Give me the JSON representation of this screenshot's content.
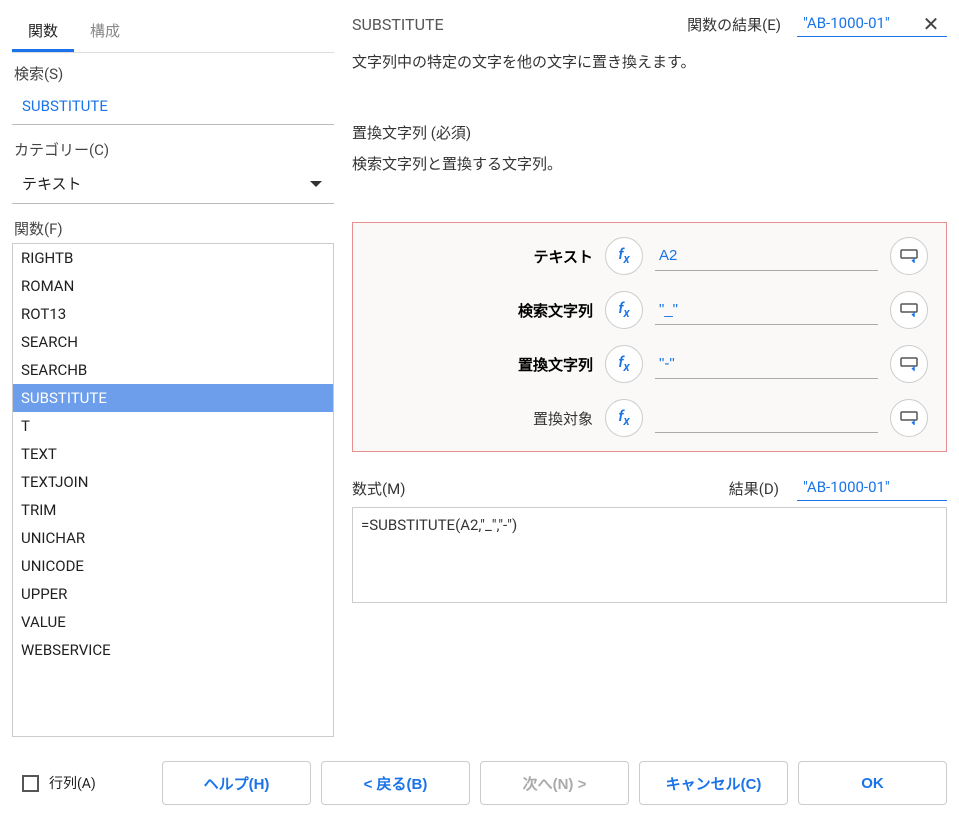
{
  "close_icon": "close-icon",
  "tabs": {
    "items": [
      {
        "label": "関数"
      },
      {
        "label": "構成"
      }
    ],
    "active_index": 0
  },
  "search": {
    "label": "検索(S)",
    "value": "SUBSTITUTE"
  },
  "category": {
    "label": "カテゴリー(C)",
    "value": "テキスト"
  },
  "functions": {
    "label": "関数(F)",
    "items": [
      "RIGHTB",
      "ROMAN",
      "ROT13",
      "SEARCH",
      "SEARCHB",
      "SUBSTITUTE",
      "T",
      "TEXT",
      "TEXTJOIN",
      "TRIM",
      "UNICHAR",
      "UNICODE",
      "UPPER",
      "VALUE",
      "WEBSERVICE"
    ],
    "selected": "SUBSTITUTE"
  },
  "right": {
    "title": "SUBSTITUTE",
    "result_e_label": "関数の結果(E)",
    "result_e_value": "\"AB-1000-01\"",
    "description": "文字列中の特定の文字を他の文字に置き換えます。",
    "param_help_title": "置換文字列 (必須)",
    "param_help_desc": "検索文字列と置換する文字列。",
    "params": [
      {
        "label": "テキスト",
        "value": "A2",
        "bold": true
      },
      {
        "label": "検索文字列",
        "value": "\"_\"",
        "bold": true
      },
      {
        "label": "置換文字列",
        "value": "\"-\"",
        "bold": true
      },
      {
        "label": "置換対象",
        "value": "",
        "bold": false
      }
    ],
    "formula_label": "数式(M)",
    "result_d_label": "結果(D)",
    "result_d_value": "\"AB-1000-01\"",
    "formula_value": "=SUBSTITUTE(A2,\"_\",\"-\")"
  },
  "footer": {
    "array_label": "行列(A)",
    "help": "ヘルプ(H)",
    "back": "< 戻る(B)",
    "next": "次へ(N) >",
    "cancel": "キャンセル(C)",
    "ok": "OK"
  }
}
